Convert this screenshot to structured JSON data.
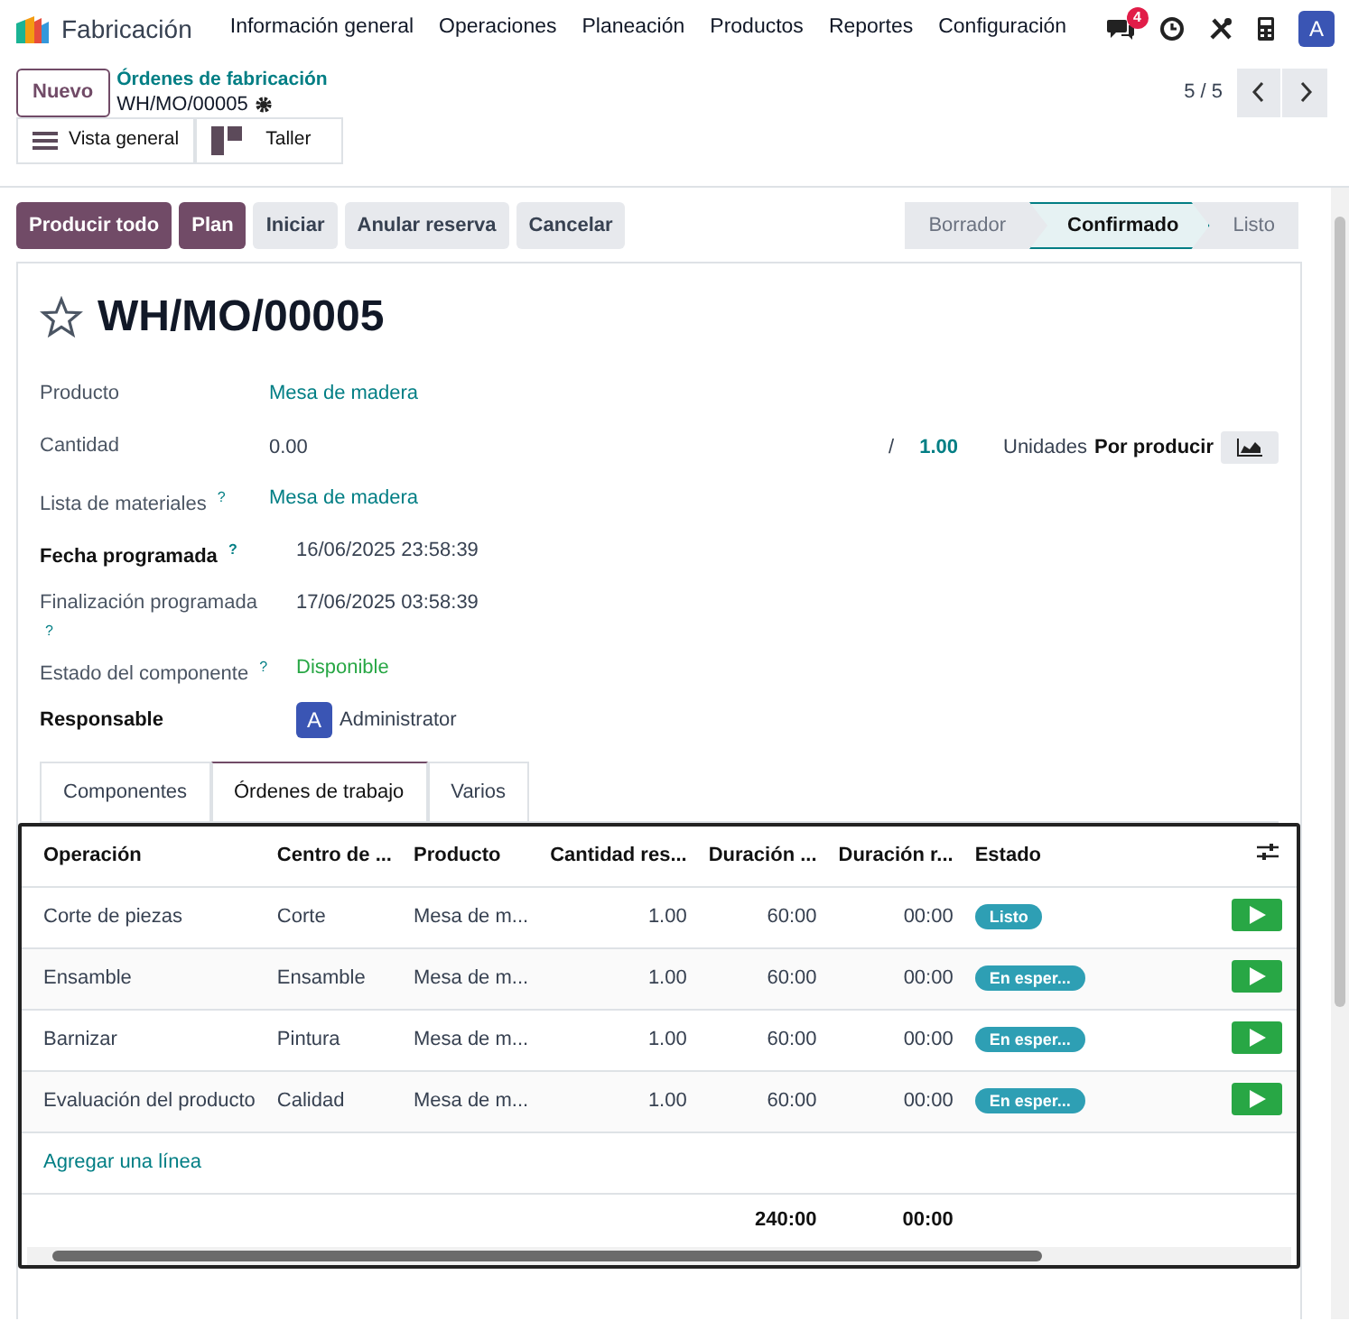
{
  "app": {
    "name": "Fabricación",
    "menu": [
      "Información general",
      "Operaciones",
      "Planeación",
      "Productos",
      "Reportes",
      "Configuración"
    ],
    "message_count": "4",
    "user_initial": "A"
  },
  "control_panel": {
    "new_button": "Nuevo",
    "breadcrumb": "Órdenes de fabricación",
    "record": "WH/MO/00005",
    "pager": "5 / 5",
    "views": [
      {
        "label": "Vista general",
        "kind": "list"
      },
      {
        "label": "Taller",
        "kind": "kanban"
      }
    ]
  },
  "actions": [
    {
      "label": "Producir todo",
      "primary": true
    },
    {
      "label": "Plan",
      "primary": true
    },
    {
      "label": "Iniciar",
      "primary": false
    },
    {
      "label": "Anular reserva",
      "primary": false
    },
    {
      "label": "Cancelar",
      "primary": false
    }
  ],
  "status_steps": [
    {
      "label": "Borrador",
      "selected": false
    },
    {
      "label": "Confirmado",
      "selected": true
    },
    {
      "label": "Listo",
      "selected": false
    }
  ],
  "title": "WH/MO/00005",
  "fields": [
    {
      "label": "Producto",
      "required": false,
      "kind": "link",
      "value": "Mesa de madera"
    },
    {
      "label": "Cantidad",
      "required": false,
      "kind": "quantity",
      "value": "0.00",
      "separator": "/",
      "target": "1.00",
      "unit": "Unidades",
      "action": "Por producir"
    },
    {
      "label": "Lista de materiales",
      "help": "?",
      "required": false,
      "kind": "link",
      "value": "Mesa de madera"
    },
    {
      "label": "Fecha programada",
      "help": "?",
      "required": true,
      "kind": "text",
      "value": "16/06/2025 23:58:39"
    },
    {
      "label": "Finalización programada",
      "help": "?",
      "required": false,
      "kind": "text",
      "value": "17/06/2025 03:58:39"
    },
    {
      "label": "Estado del componente",
      "help": "?",
      "required": false,
      "kind": "status",
      "value": "Disponible"
    },
    {
      "label": "Responsable",
      "required": true,
      "kind": "user",
      "initial": "A",
      "value": "Administrator"
    }
  ],
  "tabs": [
    {
      "label": "Componentes",
      "selected": false
    },
    {
      "label": "Órdenes de trabajo",
      "selected": true
    },
    {
      "label": "Varios",
      "selected": false
    }
  ],
  "table": {
    "columns": [
      "Operación",
      "Centro de ...",
      "Producto",
      "Cantidad res...",
      "Duración ...",
      "Duración r...",
      "Estado"
    ],
    "rows": [
      {
        "cells": [
          "Corte de piezas",
          "Corte",
          "Mesa de m...",
          "1.00",
          "60:00",
          "00:00"
        ],
        "state": "Listo"
      },
      {
        "cells": [
          "Ensamble",
          "Ensamble",
          "Mesa de m...",
          "1.00",
          "60:00",
          "00:00"
        ],
        "state": "En esper..."
      },
      {
        "cells": [
          "Barnizar",
          "Pintura",
          "Mesa de m...",
          "1.00",
          "60:00",
          "00:00"
        ],
        "state": "En esper..."
      },
      {
        "cells": [
          "Evaluación del producto",
          "Calidad",
          "Mesa de m...",
          "1.00",
          "60:00",
          "00:00"
        ],
        "state": "En esper..."
      }
    ],
    "add_line": "Agregar una línea",
    "totals": [
      "240:00",
      "00:00"
    ]
  }
}
